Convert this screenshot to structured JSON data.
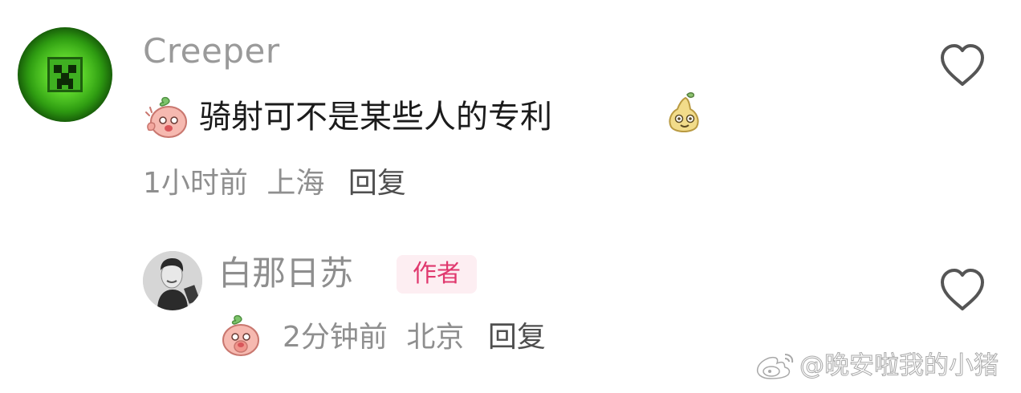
{
  "comment": {
    "username": "Creeper",
    "text": "骑射可不是某些人的专利",
    "time": "1小时前",
    "location": "上海",
    "reply_label": "回复",
    "emoji_start": "peach-emoji",
    "emoji_end": "pear-emoji"
  },
  "reply": {
    "username": "白那日苏",
    "badge": "作者",
    "emoji": "peach-emoji",
    "time": "2分钟前",
    "location": "北京",
    "reply_label": "回复"
  },
  "icons": {
    "like": "heart-outline-icon"
  },
  "watermark": {
    "text": "@晚安啦我的小猪",
    "logo": "weibo-icon"
  },
  "colors": {
    "username": "#9a9a9a",
    "badge_text": "#e0386e",
    "badge_bg": "#fdeef2",
    "meta": "#8f8f8f"
  }
}
